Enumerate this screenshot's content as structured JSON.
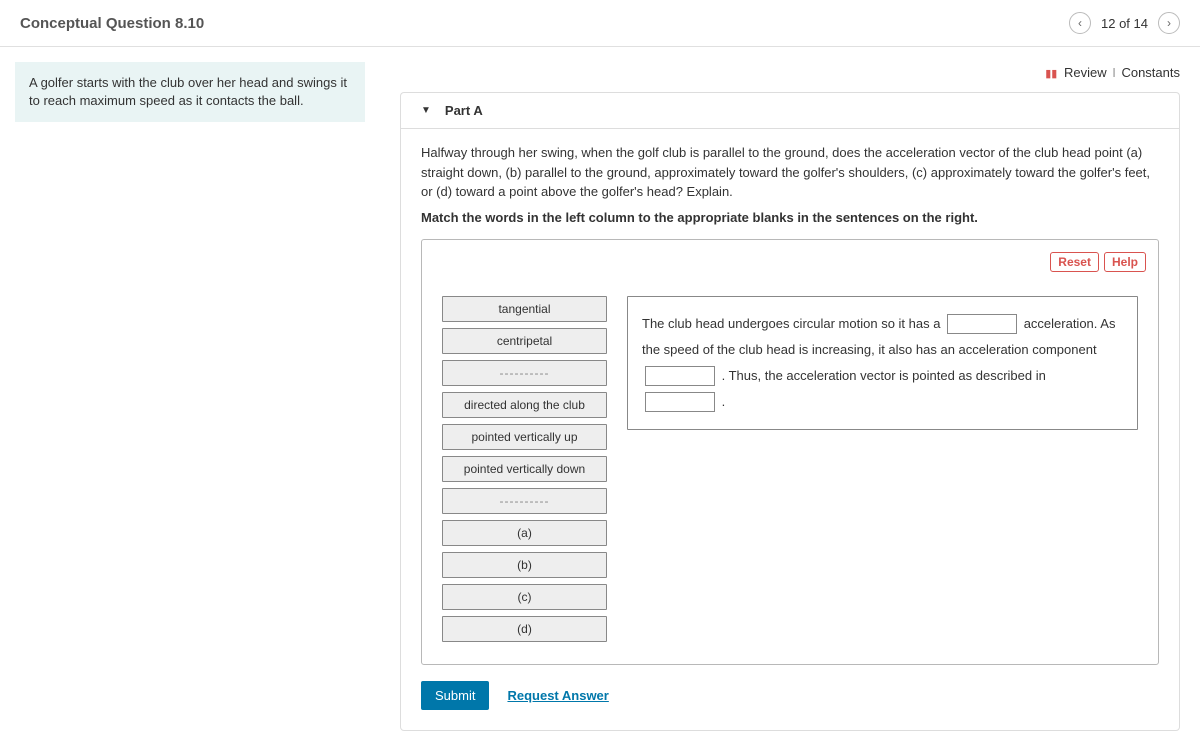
{
  "header": {
    "title": "Conceptual Question 8.10",
    "position": "12 of 14"
  },
  "topLinks": {
    "review": "Review",
    "constants": "Constants"
  },
  "sidebar": {
    "problemText": "A golfer starts with the club over her head and swings it to reach maximum speed as it contacts the ball."
  },
  "part": {
    "label": "Part A",
    "question": "Halfway through her swing, when the golf club is parallel to the ground, does the acceleration vector of the club head point (a) straight down, (b) parallel to the ground, approximately toward the golfer's shoulders, (c) approximately toward the golfer's feet, or (d) toward a point above the golfer's head? Explain.",
    "instruction": "Match the words in the left column to the appropriate blanks in the sentences on the right."
  },
  "toolbar": {
    "reset": "Reset",
    "help": "Help"
  },
  "wordBank": {
    "items": [
      "tangential",
      "centripetal",
      "----------",
      "directed along the club",
      "pointed vertically up",
      "pointed vertically down",
      "----------",
      "(a)",
      "(b)",
      "(c)",
      "(d)"
    ]
  },
  "sentence": {
    "seg1": "The club head undergoes circular motion so it has a ",
    "seg2": " acceleration. As the speed of the club head is increasing, it also has an acceleration component ",
    "seg3": " . Thus, the acceleration vector is pointed as described in ",
    "seg4": " ."
  },
  "actions": {
    "submit": "Submit",
    "request": "Request Answer"
  }
}
